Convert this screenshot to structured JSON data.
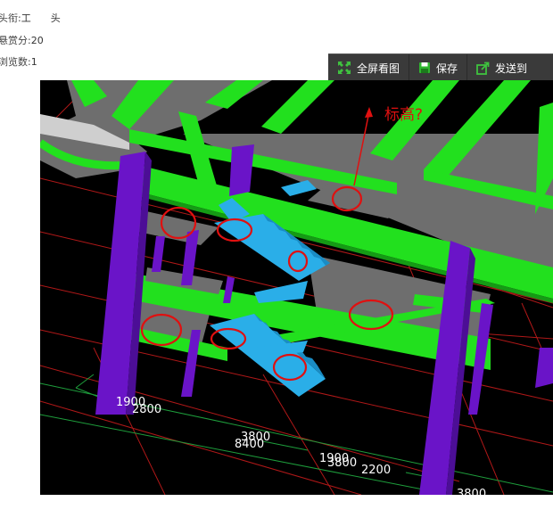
{
  "post": {
    "meta": [
      {
        "label": "头衔:",
        "value": "工　　头"
      },
      {
        "label": "悬赏分:",
        "value": "20"
      },
      {
        "label": "浏览数:",
        "value": "1"
      }
    ]
  },
  "toolbar": {
    "fullscreen_label": "全屏看图",
    "save_label": "保存",
    "send_label": "发送到"
  },
  "image": {
    "annotation": "标高?",
    "dimensions": [
      "1900",
      "2800",
      "3800",
      "8400",
      "1900",
      "3800",
      "2200",
      "3800"
    ],
    "colors": {
      "background": "#000000",
      "beam": "#22e01e",
      "slab": "#6e6e6e",
      "column": "#6a14c8",
      "stair": "#2aaee8",
      "marker": "#e01010",
      "gridline": "#c81e1e",
      "dimline": "#1e9e3c"
    }
  }
}
